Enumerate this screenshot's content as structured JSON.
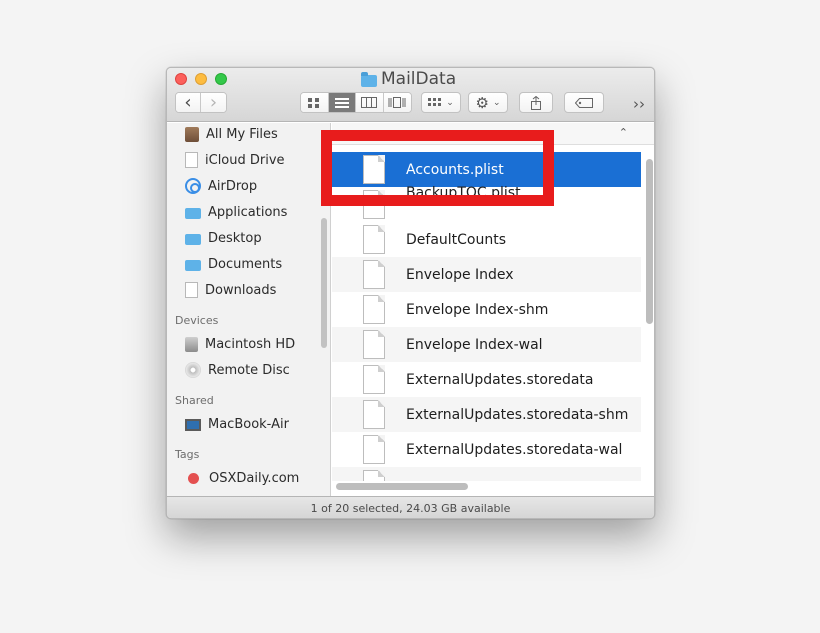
{
  "window": {
    "title": "MailData"
  },
  "toolbar": {
    "back_icon": "chevron-left-icon",
    "forward_icon": "chevron-right-icon",
    "views": [
      "icon-view-icon",
      "list-view-icon",
      "column-view-icon",
      "coverflow-view-icon"
    ],
    "active_view": 1,
    "arrange_icon": "grid-icon",
    "action_icon": "gear-icon",
    "share_icon": "share-icon",
    "tag_icon": "tag-icon",
    "overflow_icon": "double-chevron-right-icon"
  },
  "sidebar": {
    "favorites": [
      {
        "label": "All My Files",
        "icon": "all-files-icon"
      },
      {
        "label": "iCloud Drive",
        "icon": "document-icon"
      },
      {
        "label": "AirDrop",
        "icon": "airdrop-icon"
      },
      {
        "label": "Applications",
        "icon": "folder-icon"
      },
      {
        "label": "Desktop",
        "icon": "folder-icon"
      },
      {
        "label": "Documents",
        "icon": "folder-icon"
      },
      {
        "label": "Downloads",
        "icon": "document-icon"
      }
    ],
    "devices_header": "Devices",
    "devices": [
      {
        "label": "Macintosh HD",
        "icon": "hard-drive-icon"
      },
      {
        "label": "Remote Disc",
        "icon": "disc-icon"
      }
    ],
    "shared_header": "Shared",
    "shared": [
      {
        "label": "MacBook-Air",
        "icon": "monitor-icon"
      }
    ],
    "tags_header": "Tags",
    "tags": [
      {
        "label": "OSXDaily.com",
        "color": "#e45050"
      }
    ]
  },
  "files": [
    {
      "name": "Accounts.plist",
      "selected": true
    },
    {
      "name": "BackupTOC.plist",
      "selected": false
    },
    {
      "name": "DefaultCounts",
      "selected": false
    },
    {
      "name": "Envelope Index",
      "selected": false
    },
    {
      "name": "Envelope Index-shm",
      "selected": false
    },
    {
      "name": "Envelope Index-wal",
      "selected": false
    },
    {
      "name": "ExternalUpdates.storedata",
      "selected": false
    },
    {
      "name": "ExternalUpdates.storedata-shm",
      "selected": false
    },
    {
      "name": "ExternalUpdates.storedata-wal",
      "selected": false
    }
  ],
  "status": {
    "text": "1 of 20 selected, 24.03 GB available"
  },
  "colors": {
    "selection": "#1a6fd4",
    "highlight_box": "#e81c1c"
  }
}
